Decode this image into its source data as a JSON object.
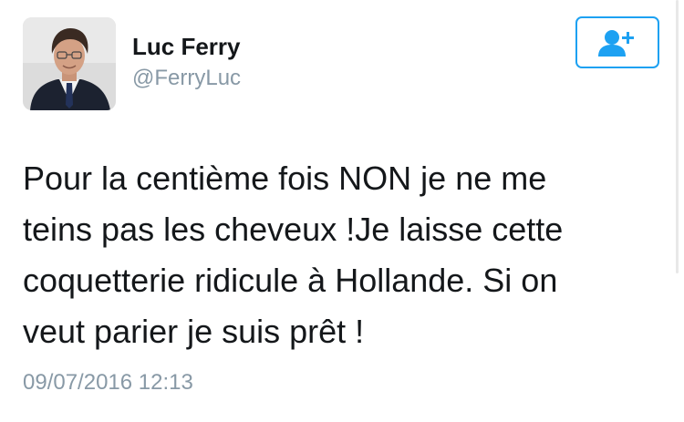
{
  "author": {
    "display_name": "Luc Ferry",
    "handle": "@FerryLuc",
    "avatar_icon": "profile-photo"
  },
  "follow_button": {
    "icon": "add-user-icon",
    "color": "#1da1f2"
  },
  "tweet": {
    "text": "Pour la centième fois NON je ne me\nteins pas les cheveux !Je laisse cette\ncoquetterie ridicule à Hollande. Si  on\nveut parier je suis prêt !",
    "timestamp": "09/07/2016 12:13"
  },
  "colors": {
    "text": "#14171a",
    "secondary": "#8899a6",
    "accent": "#1da1f2"
  }
}
